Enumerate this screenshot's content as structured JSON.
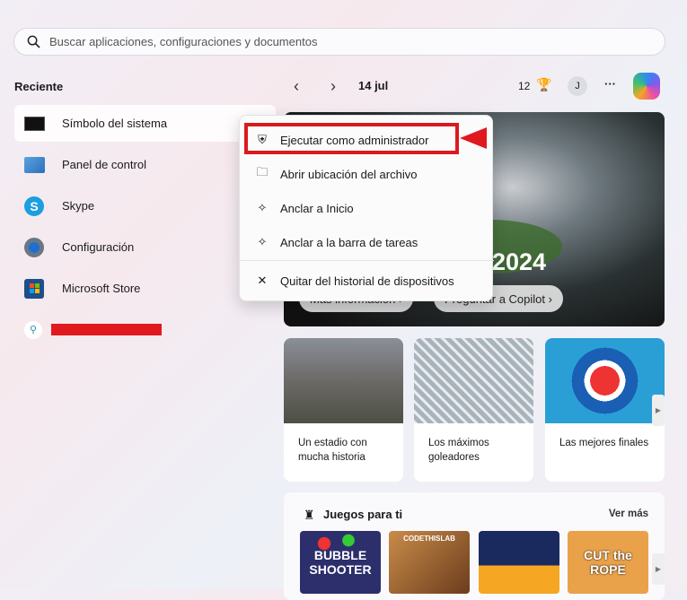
{
  "search": {
    "placeholder": "Buscar aplicaciones, configuraciones y documentos"
  },
  "recent": {
    "title": "Reciente",
    "items": [
      {
        "label": "Símbolo del sistema",
        "icon": "cmd-icon"
      },
      {
        "label": "Panel de control",
        "icon": "control-panel-icon"
      },
      {
        "label": "Skype",
        "icon": "skype-icon"
      },
      {
        "label": "Configuración",
        "icon": "settings-gear-icon"
      },
      {
        "label": "Microsoft Store",
        "icon": "store-icon"
      }
    ]
  },
  "header": {
    "date": "14 jul",
    "points": "12",
    "avatar": "J",
    "more": "···"
  },
  "hero": {
    "year": "2024",
    "buttons": [
      "Más información ›",
      "Preguntar a Copilot ›"
    ]
  },
  "context_menu": {
    "items": [
      "Ejecutar como administrador",
      "Abrir ubicación del archivo",
      "Anclar a Inicio",
      "Anclar a la barra de tareas",
      "Quitar del historial de dispositivos"
    ]
  },
  "cards": [
    {
      "title": "Un estadio con mucha historia"
    },
    {
      "title": "Los máximos goleadores"
    },
    {
      "title": "Las mejores finales"
    }
  ],
  "games": {
    "title": "Juegos para ti",
    "see_more": "Ver más",
    "tiles": [
      "BUBBLE SHOOTER",
      "CODETHISLAB",
      "",
      "CUT the ROPE"
    ]
  },
  "colors": {
    "highlight": "#e0191e"
  }
}
